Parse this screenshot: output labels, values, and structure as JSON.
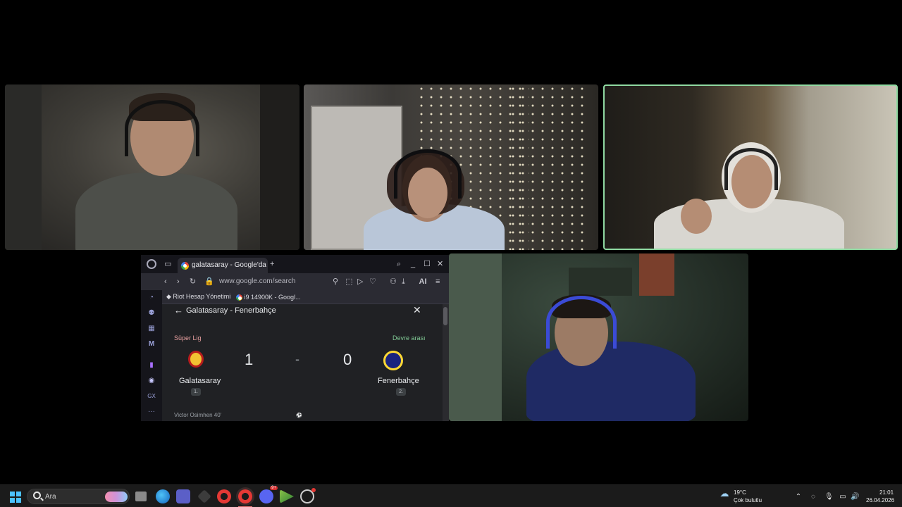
{
  "browser": {
    "tab_title": "galatasaray - Google'da Ara",
    "new_tab": "+",
    "url": "www.google.com/search",
    "ai_label": "AI",
    "bookmarks": [
      {
        "label": "Riot Hesap Yönetimi"
      },
      {
        "label": "i9 14900K - Googl..."
      }
    ]
  },
  "match": {
    "title": "Galatasaray - Fenerbahçe",
    "league": "Süper Lig",
    "status": "Devre arası",
    "home": {
      "name": "Galatasaray",
      "rank": "1.",
      "score": "1"
    },
    "away": {
      "name": "Fenerbahçe",
      "rank": "2.",
      "score": "0"
    },
    "separator": "-",
    "scorer": "Victor Osimhen 40'"
  },
  "taskbar": {
    "search_placeholder": "Ara",
    "weather_temp": "19°C",
    "weather_desc": "Çok bulutlu",
    "time": "21:01",
    "date": "26.04.2026",
    "discord_badge": "9+"
  },
  "colors": {
    "active_speaker_border": "#8fd9a1",
    "status_green": "#81c995",
    "league_red": "#e8a0a0",
    "accent_blue": "#4cc2ff"
  }
}
